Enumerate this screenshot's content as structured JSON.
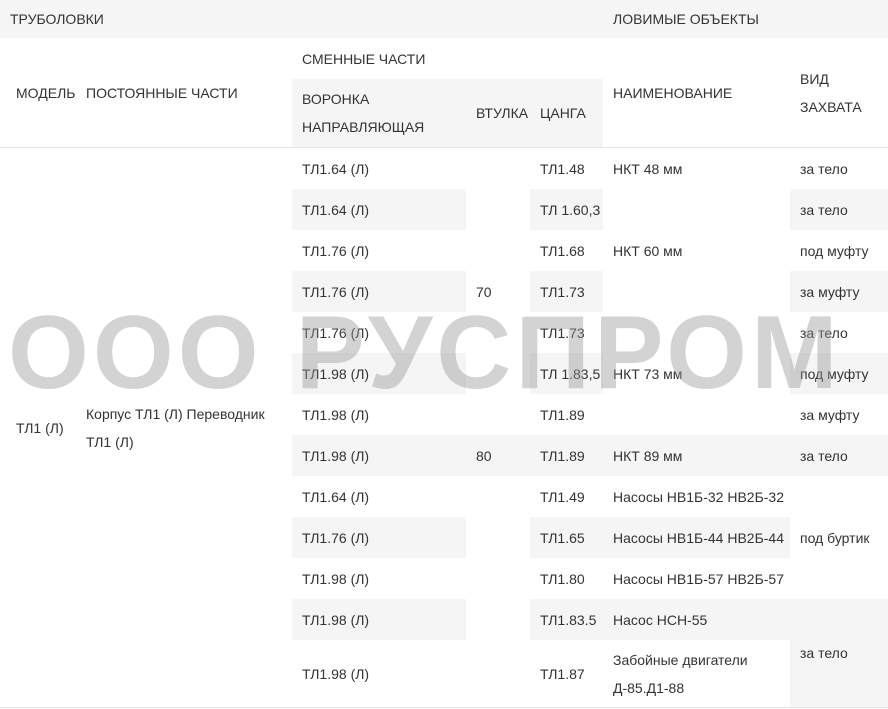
{
  "watermark": "ООО РУСПРОМ",
  "header": {
    "group_left": "ТРУБОЛОВКИ",
    "group_right": "ЛОВИМЫЕ ОБЪЕКТЫ",
    "model": "МОДЕЛЬ",
    "permanent": "ПОСТОЯННЫЕ ЧАСТИ",
    "replaceable": "СМЕННЫЕ ЧАСТИ",
    "funnel": "ВОРОНКА НАПРАВЛЯЮЩАЯ",
    "sleeve": "ВТУЛКА",
    "collet": "ЦАНГА",
    "name": "НАИМЕНОВАНИЕ",
    "grip": "ВИД ЗАХВАТА"
  },
  "body": {
    "model": "ТЛ1 (Л)",
    "permanent": "Корпус ТЛ1 (Л) Переводник ТЛ1 (Л)",
    "funnels": [
      "ТЛ1.64 (Л)",
      "ТЛ1.64 (Л)",
      "ТЛ1.76 (Л)",
      "ТЛ1.76 (Л)",
      "ТЛ1.76 (Л)",
      "ТЛ1.98 (Л)",
      "ТЛ1.98 (Л)",
      "ТЛ1.98 (Л)",
      "ТЛ1.64 (Л)",
      "ТЛ1.76 (Л)",
      "ТЛ1.98 (Л)",
      "ТЛ1.98 (Л)",
      "ТЛ1.98 (Л)"
    ],
    "collets": [
      "ТЛ1.48",
      "ТЛ 1.60,3",
      "ТЛ1.68",
      "ТЛ1.73",
      "ТЛ1.73",
      "ТЛ 1.83,5",
      "ТЛ1.89",
      "ТЛ1.89",
      "ТЛ1.49",
      "ТЛ1.65",
      "ТЛ1.80",
      "ТЛ1.83.5",
      "ТЛ1.87"
    ],
    "sleeves": [
      "70",
      "80"
    ],
    "names": [
      "НКТ 48 мм",
      "НКТ 60 мм",
      "НКТ 73 мм",
      "НКТ 89 мм",
      "Насосы НВ1Б-32 НВ2Б-32",
      "Насосы НВ1Б-44 НВ2Б-44",
      "Насосы НВ1Б-57 НВ2Б-57",
      "Насос НСН-55",
      "Забойные двигатели Д-85.Д1-88"
    ],
    "grips": [
      "за тело",
      "за тело",
      "под муфту",
      "за муфту",
      "за тело",
      "под муфту",
      "за муфту",
      "за тело",
      "под буртик",
      "за тело"
    ]
  }
}
